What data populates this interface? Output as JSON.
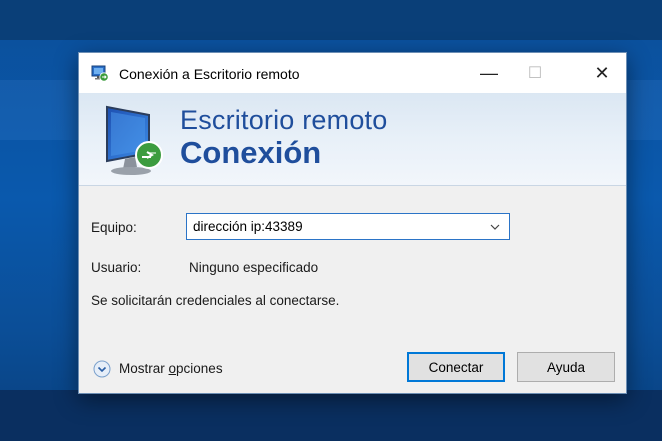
{
  "window": {
    "title": "Conexión a Escritorio remoto",
    "controls": {
      "minimize": "—",
      "maximize": "☐",
      "close": "✕"
    }
  },
  "banner": {
    "line1": "Escritorio remoto",
    "line2": "Conexión"
  },
  "form": {
    "computer_label": "Equipo:",
    "computer_value": "dirección ip:43389",
    "user_label": "Usuario:",
    "user_value": "Ninguno especificado",
    "notice": "Se solicitarán credenciales al conectarse."
  },
  "footer": {
    "options_prefix": "Mostrar ",
    "options_underlined": "o",
    "options_suffix": "pciones",
    "connect_label": "Conectar",
    "help_label": "Ayuda"
  },
  "icons": {
    "title": "remote-desktop-icon",
    "banner": "remote-desktop-monitor-icon",
    "dropdown": "chevron-down-icon",
    "options": "expand-circle-icon"
  },
  "colors": {
    "accent": "#0078d7",
    "banner_text": "#1f4e9c",
    "wallpaper": "#0a59ad"
  }
}
